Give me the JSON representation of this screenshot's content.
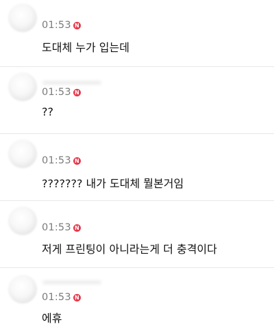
{
  "comments": [
    {
      "time": "01:53",
      "badge": "N",
      "text": "도대체 누가 입는데"
    },
    {
      "time": "01:53",
      "badge": "N",
      "text": "??"
    },
    {
      "time": "01:53",
      "badge": "N",
      "text": "??????? 내가 도대체 뭘본거임"
    },
    {
      "time": "01:53",
      "badge": "N",
      "text": "저게 프린팅이 아니라는게 더 충격이다"
    },
    {
      "time": "01:53",
      "badge": "N",
      "text": "에휴"
    }
  ],
  "colors": {
    "badge": "#e8384b",
    "time": "#7b7b7b",
    "divider": "#e7e7e7"
  }
}
